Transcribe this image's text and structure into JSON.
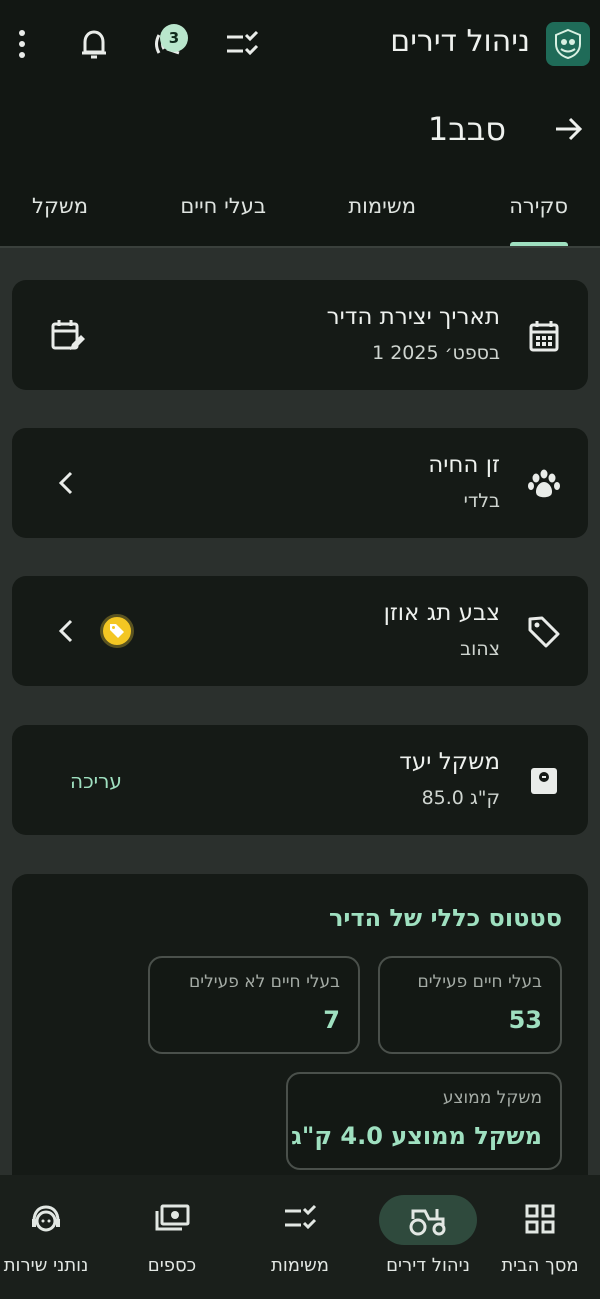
{
  "app": {
    "title": "ניהול דירים",
    "notification_count": "3"
  },
  "page": {
    "title": "סבב1"
  },
  "tabs": [
    {
      "label": "סקירה",
      "active": true
    },
    {
      "label": "משימות",
      "active": false
    },
    {
      "label": "בעלי חיים",
      "active": false
    },
    {
      "label": "משקל",
      "active": false
    }
  ],
  "cards": {
    "created": {
      "title": "תאריך יצירת הדיר",
      "value": "1 בספט׳ 2025"
    },
    "breed": {
      "title": "זן החיה",
      "value": "בלדי"
    },
    "tag": {
      "title": "צבע תג אוזן",
      "value": "צהוב",
      "color": "#f3c623"
    },
    "target": {
      "title": "משקל יעד",
      "value": "85.0 ק\"ג",
      "edit_label": "עריכה"
    }
  },
  "status": {
    "title": "סטטוס כללי של הדיר",
    "active_label": "בעלי חיים פעילים",
    "active_value": "53",
    "inactive_label": "בעלי חיים לא פעילים",
    "inactive_value": "7",
    "avg_label": "משקל ממוצע",
    "avg_value": "משקל ממוצע 4.0 ק\"ג"
  },
  "bottom_nav": [
    {
      "label": "מסך הבית",
      "icon": "grid-icon",
      "active": false
    },
    {
      "label": "ניהול דירים",
      "icon": "tractor-icon",
      "active": true
    },
    {
      "label": "משימות",
      "icon": "checklist-icon",
      "active": false
    },
    {
      "label": "כספים",
      "icon": "money-icon",
      "active": false
    },
    {
      "label": "נותני שירות",
      "icon": "support-agent-icon",
      "active": false
    }
  ],
  "colors": {
    "accent": "#9fe0c0",
    "background": "#2b302d",
    "card": "#151a16",
    "header": "#121713"
  }
}
